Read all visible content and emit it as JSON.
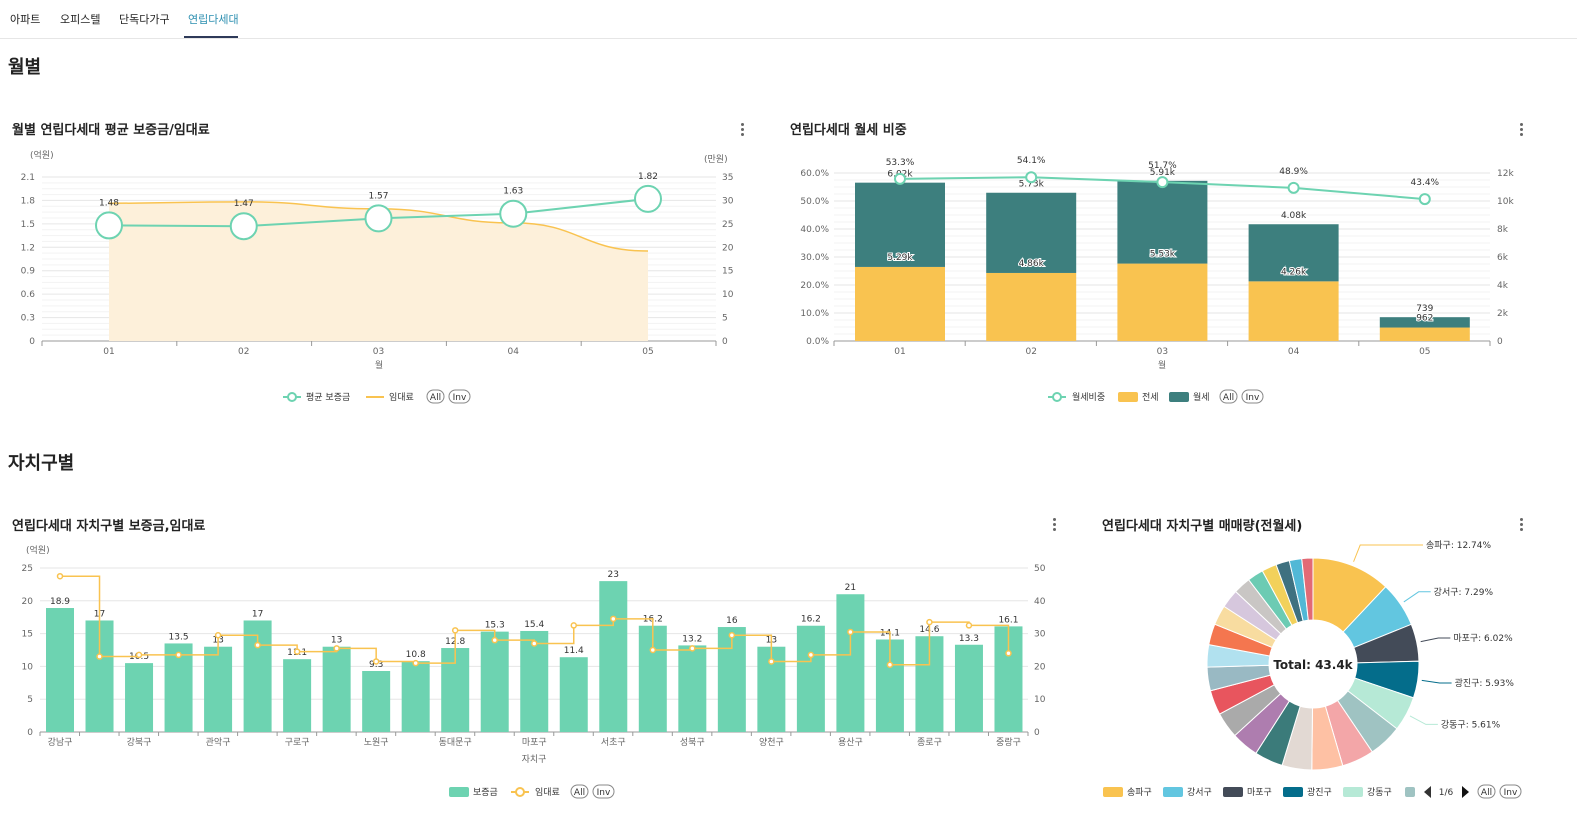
{
  "tabs": [
    {
      "label": "아파트",
      "active": false
    },
    {
      "label": "오피스텔",
      "active": false
    },
    {
      "label": "단독다가구",
      "active": false
    },
    {
      "label": "연립다세대",
      "active": true
    }
  ],
  "sections": {
    "monthly": "월별",
    "district": "자치구별"
  },
  "colors": {
    "teal": "#6dd3b1",
    "yellow": "#f9c350",
    "dark_teal": "#3d7f7e",
    "fill_yellow": "#fdf0da"
  },
  "legend_buttons": {
    "all": "All",
    "inv": "Inv"
  },
  "chart_data": [
    {
      "id": "monthly_deposit_rent",
      "type": "line",
      "title": "월별 연립다세대 평균 보증금/임대료",
      "xlabel": "월",
      "y_left_unit": "(억원)",
      "y_right_unit": "(만원)",
      "categories": [
        "01",
        "02",
        "03",
        "04",
        "05"
      ],
      "y_left_ticks": [
        "0",
        "0.3",
        "0.6",
        "0.9",
        "1.2",
        "1.5",
        "1.8",
        "2.1"
      ],
      "y_right_ticks": [
        "0",
        "5",
        "10",
        "15",
        "20",
        "25",
        "30",
        "35"
      ],
      "ylim_left": [
        0,
        2.1
      ],
      "ylim_right": [
        0,
        35
      ],
      "series": [
        {
          "name": "평균 보증금",
          "axis": "left",
          "values": [
            1.48,
            1.47,
            1.57,
            1.63,
            1.82
          ],
          "labels": [
            "1.48",
            "1.47",
            "1.57",
            "1.63",
            "1.82"
          ]
        },
        {
          "name": "임대료",
          "axis": "right",
          "values": [
            29.4,
            29.7,
            28.2,
            25.2,
            19.2
          ]
        }
      ],
      "legend": [
        "평균 보증금",
        "임대료"
      ],
      "legend_position": "bottom"
    },
    {
      "id": "monthly_rent_ratio",
      "type": "bar",
      "stacked": true,
      "title": "연립다세대 월세 비중",
      "xlabel": "월",
      "categories": [
        "01",
        "02",
        "03",
        "04",
        "05"
      ],
      "y_left_ticks": [
        "0.0%",
        "10.0%",
        "20.0%",
        "30.0%",
        "40.0%",
        "50.0%",
        "60.0%"
      ],
      "y_right_ticks": [
        "0",
        "2k",
        "4k",
        "6k",
        "8k",
        "10k",
        "12k"
      ],
      "ylim_left": [
        0,
        60
      ],
      "ylim_right": [
        0,
        12000
      ],
      "series": [
        {
          "name": "전세",
          "axis": "right",
          "values": [
            5290,
            4860,
            5530,
            4260,
            962
          ],
          "labels": [
            "5.29k",
            "4.86k",
            "5.53k",
            "4.26k",
            "962"
          ]
        },
        {
          "name": "월세",
          "axis": "right",
          "values": [
            6020,
            5730,
            5910,
            4080,
            739
          ],
          "labels": [
            "6.02k",
            "5.73k",
            "5.91k",
            "4.08k",
            "739"
          ]
        },
        {
          "name": "월세비중",
          "axis": "left",
          "type": "line",
          "values": [
            53.3,
            54.1,
            51.7,
            48.9,
            43.4
          ],
          "labels": [
            "53.3%",
            "54.1%",
            "51.7%",
            "48.9%",
            "43.4%"
          ]
        }
      ],
      "legend": [
        "월세비중",
        "전세",
        "월세"
      ],
      "legend_position": "bottom"
    },
    {
      "id": "district_deposit_rent",
      "type": "bar",
      "title": "연립다세대 자치구별 보증금,임대료",
      "xlabel": "자치구",
      "y_left_unit": "(억원)",
      "y_left_ticks": [
        "0",
        "5",
        "10",
        "15",
        "20",
        "25"
      ],
      "y_right_ticks": [
        "0",
        "10",
        "20",
        "30",
        "40",
        "50"
      ],
      "ylim_left": [
        0,
        25
      ],
      "ylim_right": [
        0,
        50
      ],
      "tick_labels": [
        "강남구",
        "강북구",
        "관악구",
        "구로구",
        "노원구",
        "동대문구",
        "마포구",
        "서초구",
        "성북구",
        "양천구",
        "용산구",
        "종로구",
        "중랑구"
      ],
      "series": [
        {
          "name": "보증금",
          "axis": "left",
          "values": [
            18.9,
            17,
            10.5,
            13.5,
            13,
            17,
            11.1,
            13,
            9.3,
            10.8,
            12.8,
            15.3,
            15.4,
            11.4,
            23,
            16.2,
            13.2,
            16,
            13,
            16.2,
            21,
            14.1,
            14.6,
            13.3,
            16.1
          ],
          "labels": [
            "18.9",
            "17",
            "10.5",
            "13.5",
            "13",
            "17",
            "11.1",
            "13",
            "9.3",
            "10.8",
            "12.8",
            "15.3",
            "15.4",
            "11.4",
            "23",
            "16.2",
            "13.2",
            "16",
            "13",
            "16.2",
            "21",
            "14.1",
            "14.6",
            "13.3",
            "16.1"
          ]
        },
        {
          "name": "임대료",
          "axis": "right",
          "type": "step-line",
          "values": [
            47.5,
            23,
            23.5,
            23.5,
            29.5,
            26.5,
            24.5,
            25.5,
            21.5,
            21,
            31,
            28,
            27,
            32.5,
            34.5,
            25,
            25.5,
            29.5,
            21.5,
            23.5,
            30.5,
            20.5,
            33.5,
            32.5,
            24
          ]
        }
      ],
      "legend": [
        "보증금",
        "임대료"
      ],
      "legend_position": "bottom"
    },
    {
      "id": "district_volume",
      "type": "pie",
      "donut": true,
      "title": "연립다세대 자치구별 매매량(전월세)",
      "center_text": "Total: 43.4k",
      "slices": [
        {
          "name": "송파구",
          "value": 12.74,
          "label": "송파구: 12.74%",
          "color": "#f9c350"
        },
        {
          "name": "강서구",
          "value": 7.29,
          "label": "강서구: 7.29%",
          "color": "#62c6e0"
        },
        {
          "name": "마포구",
          "value": 6.02,
          "label": "마포구: 6.02%",
          "color": "#434b58"
        },
        {
          "name": "광진구",
          "value": 5.93,
          "label": "광진구: 5.93%",
          "color": "#046d8b"
        },
        {
          "name": "강동구",
          "value": 5.61,
          "label": "강동구: 5.61%",
          "color": "#b6e9d6"
        },
        {
          "name": "",
          "value": 5.4,
          "color": "#9fc3c2"
        },
        {
          "name": "",
          "value": 5.2,
          "color": "#f3a6a8"
        },
        {
          "name": "",
          "value": 5.0,
          "color": "#fec1a4"
        },
        {
          "name": "",
          "value": 4.8,
          "color": "#e2d9d3"
        },
        {
          "name": "",
          "value": 4.6,
          "color": "#3b7b7a"
        },
        {
          "name": "",
          "value": 4.4,
          "color": "#ae7daf"
        },
        {
          "name": "",
          "value": 4.2,
          "color": "#aaaaaa"
        },
        {
          "name": "",
          "value": 4.0,
          "color": "#e8555e"
        },
        {
          "name": "",
          "value": 3.8,
          "color": "#99b9c3"
        },
        {
          "name": "",
          "value": 3.6,
          "color": "#b1e1ef"
        },
        {
          "name": "",
          "value": 3.4,
          "color": "#f4764f"
        },
        {
          "name": "",
          "value": 3.2,
          "color": "#f8dca0"
        },
        {
          "name": "",
          "value": 3.0,
          "color": "#d6c7dd"
        },
        {
          "name": "",
          "value": 2.8,
          "color": "#c9c6c4"
        },
        {
          "name": "",
          "value": 2.6,
          "color": "#6ccbb3"
        },
        {
          "name": "",
          "value": 2.4,
          "color": "#f2d15b"
        },
        {
          "name": "",
          "value": 2.2,
          "color": "#3f7180"
        },
        {
          "name": "",
          "value": 2.0,
          "color": "#52b8d6"
        },
        {
          "name": "",
          "value": 1.8,
          "color": "#e26a75"
        }
      ],
      "legend": [
        "송파구",
        "강서구",
        "마포구",
        "광진구",
        "강동구"
      ],
      "legend_page": "1/6",
      "legend_position": "bottom"
    }
  ]
}
